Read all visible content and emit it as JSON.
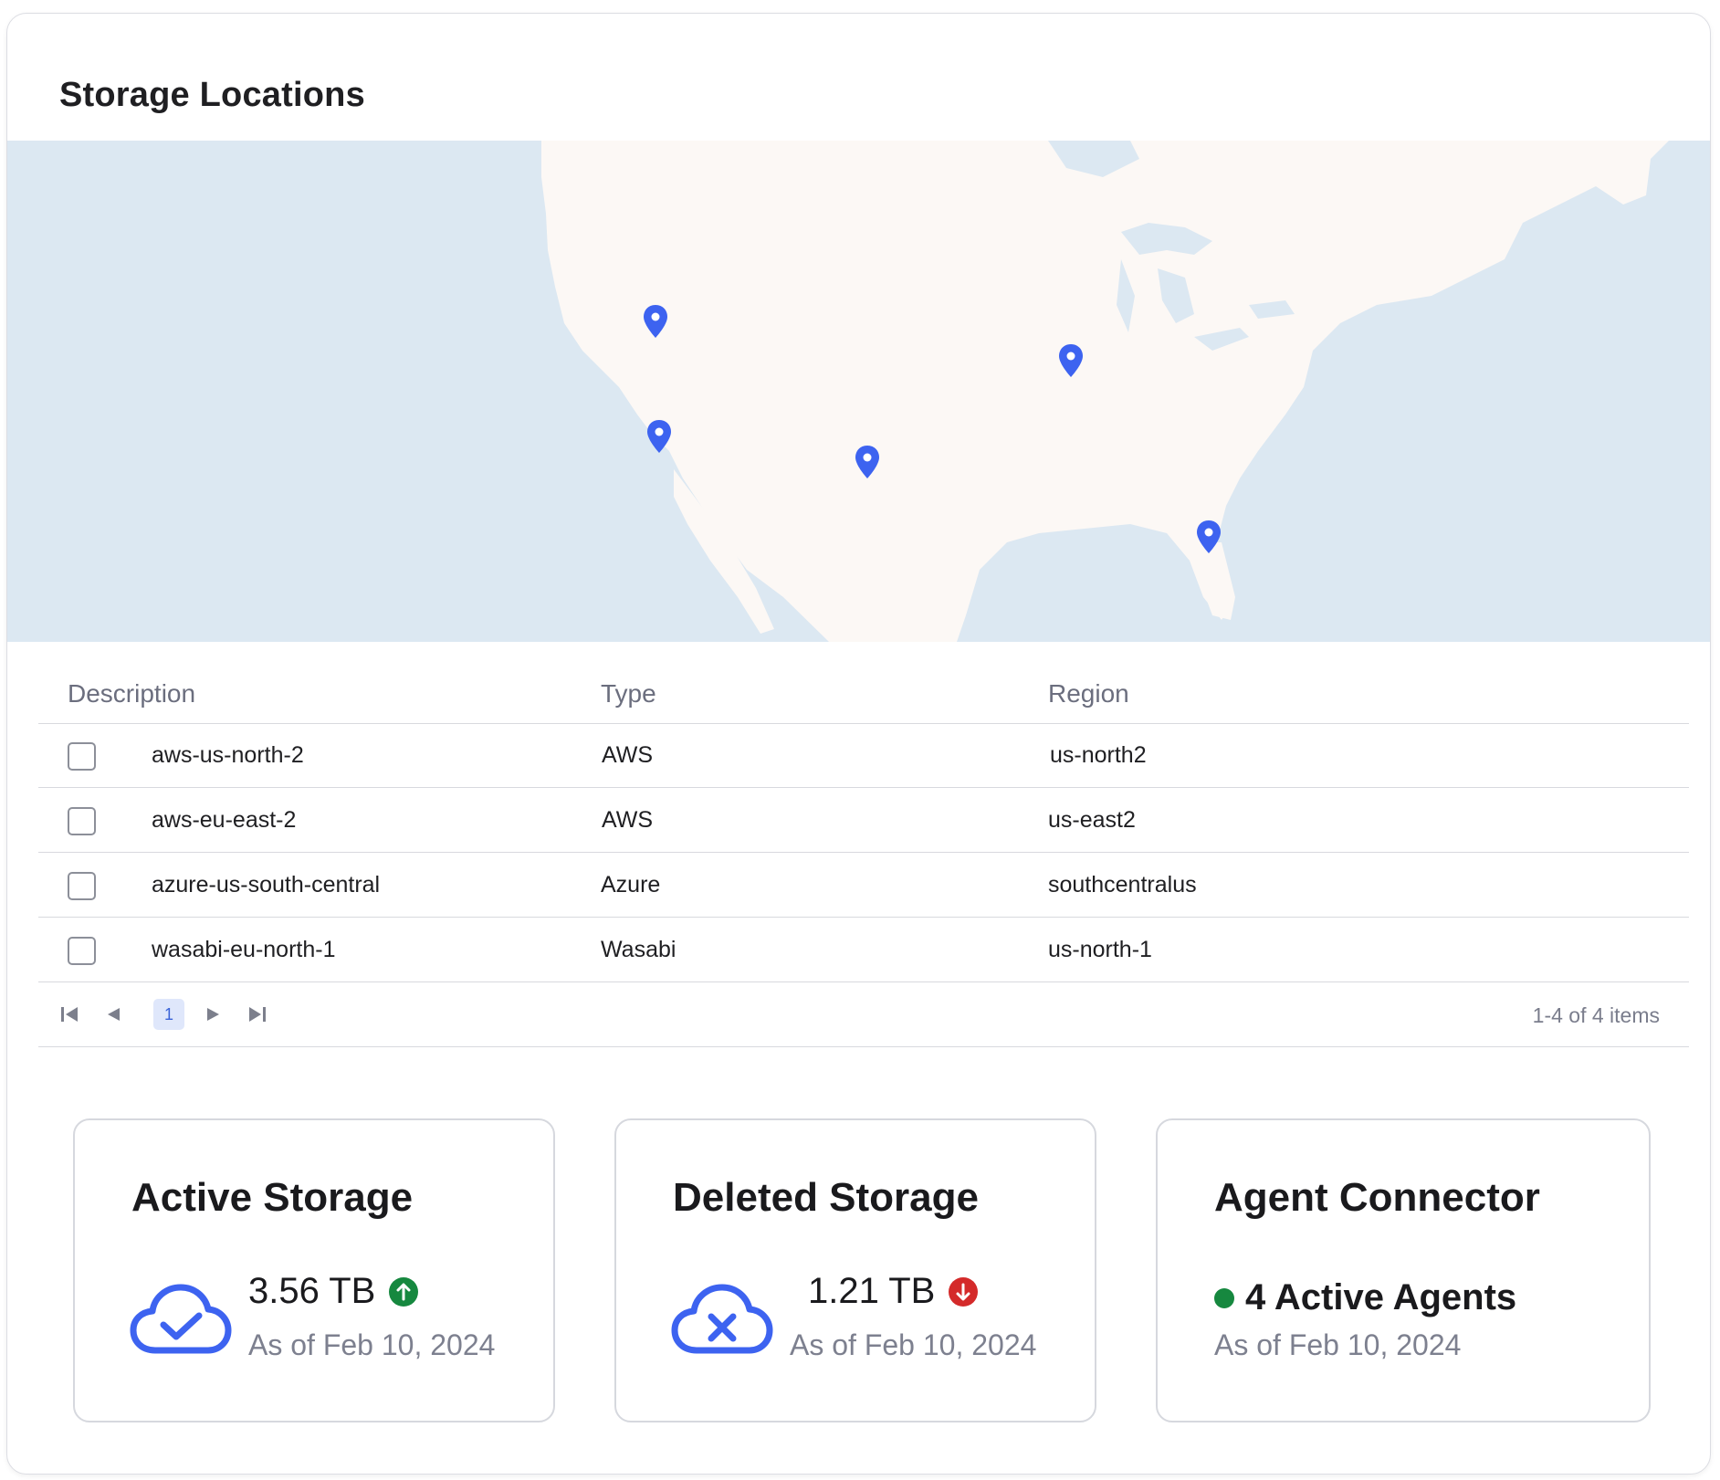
{
  "panel": {
    "title": "Storage Locations"
  },
  "map": {
    "markers": [
      {
        "name": "marker-1"
      },
      {
        "name": "marker-2"
      },
      {
        "name": "marker-3"
      },
      {
        "name": "marker-4"
      },
      {
        "name": "marker-5"
      }
    ],
    "colors": {
      "water": "#dce8f2",
      "land": "#fcf8f5",
      "marker": "#3d63f0"
    }
  },
  "table": {
    "columns": [
      "Description",
      "Type",
      "Region"
    ],
    "rows": [
      {
        "description": "aws-us-north-2",
        "type": "AWS",
        "region": "us-north2"
      },
      {
        "description": "aws-eu-east-2",
        "type": "AWS",
        "region": "us-east2"
      },
      {
        "description": "azure-us-south-central",
        "type": "Azure",
        "region": "southcentralus"
      },
      {
        "description": "wasabi-eu-north-1",
        "type": "Wasabi",
        "region": "us-north-1"
      }
    ]
  },
  "pagination": {
    "current_page": "1",
    "summary": "1-4 of 4 items"
  },
  "stats": {
    "active": {
      "title": "Active Storage",
      "value": "3.56 TB",
      "date": "As of Feb 10, 2024",
      "trend": "up",
      "color": "#16883f"
    },
    "deleted": {
      "title": "Deleted Storage",
      "value": "1.21 TB",
      "date": "As of Feb 10, 2024",
      "trend": "down",
      "color": "#d42a2a"
    },
    "agents": {
      "title": "Agent Connector",
      "value": "4 Active Agents",
      "date": "As of Feb 10, 2024",
      "status_color": "#16883f"
    }
  },
  "icons": {
    "first": "first-page-icon",
    "prev": "prev-page-icon",
    "next": "next-page-icon",
    "last": "last-page-icon",
    "cloud_check": "cloud-check-icon",
    "cloud_x": "cloud-x-icon",
    "arrow_up": "arrow-up-circle-icon",
    "arrow_down": "arrow-down-circle-icon",
    "status_dot": "status-dot-icon",
    "pin": "map-pin-icon"
  }
}
